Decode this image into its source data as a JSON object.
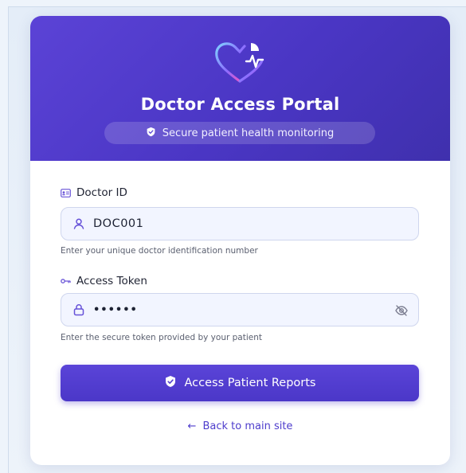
{
  "header": {
    "title": "Doctor Access Portal",
    "subtitle": "Secure patient health monitoring",
    "logo_icon": "heart-pulse-icon"
  },
  "form": {
    "doctor_id": {
      "label": "Doctor ID",
      "label_icon": "id-card-icon",
      "input_icon": "user-icon",
      "value": "DOC001",
      "help": "Enter your unique doctor identification number"
    },
    "access_token": {
      "label": "Access Token",
      "label_icon": "key-icon",
      "input_icon": "lock-icon",
      "value": "••••••",
      "toggle_icon": "eye-off-icon",
      "help": "Enter the secure token provided by your patient"
    },
    "submit": {
      "label": "Access Patient Reports",
      "icon": "shield-icon"
    }
  },
  "footer": {
    "back_arrow": "←",
    "back_label": "Back to main site"
  },
  "colors": {
    "brand": "#4f3ccf",
    "header_gradient_start": "#5b43d6",
    "header_gradient_end": "#3f30ad",
    "input_bg": "#f2f5ff",
    "page_bg": "#eef4fb"
  }
}
